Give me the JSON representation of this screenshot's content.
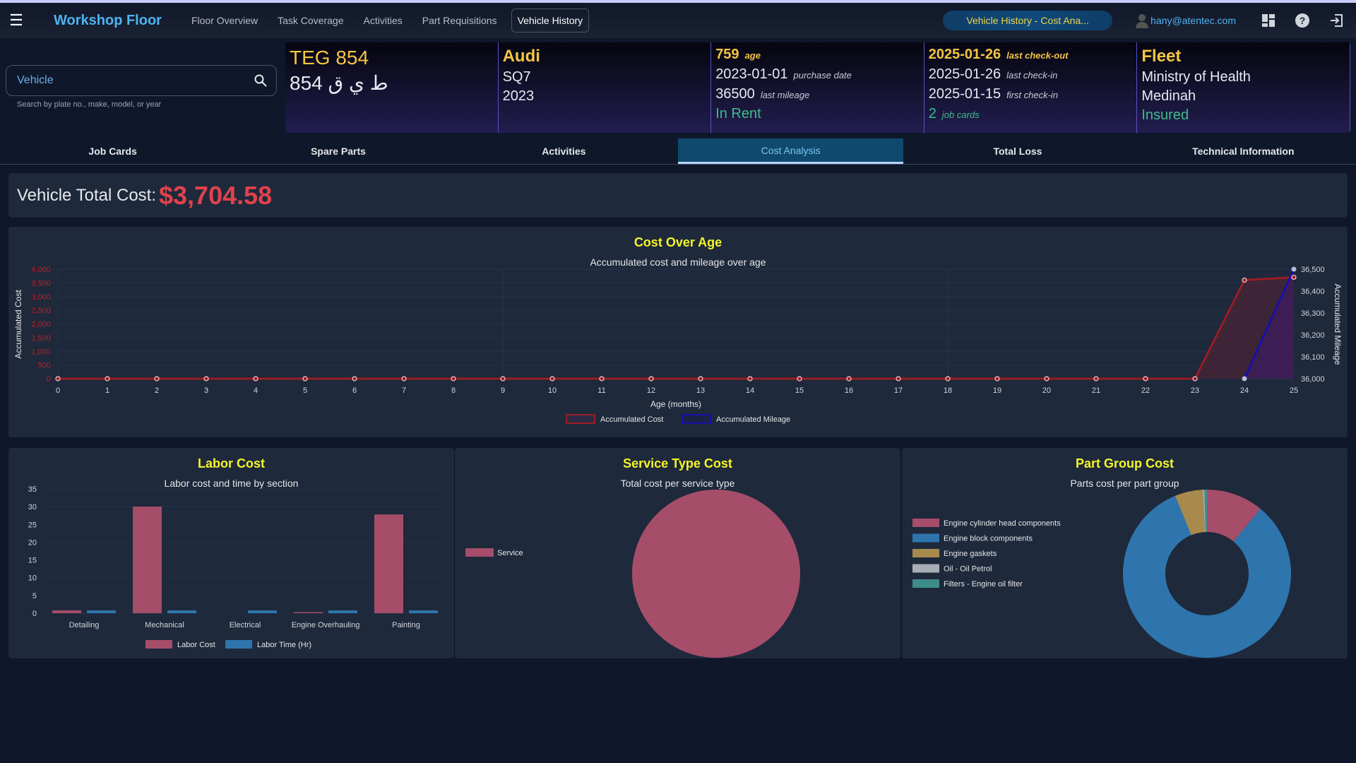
{
  "nav": {
    "brand": "Workshop Floor",
    "links": [
      {
        "label": "Floor Overview",
        "active": false
      },
      {
        "label": "Task Coverage",
        "active": false
      },
      {
        "label": "Activities",
        "active": false
      },
      {
        "label": "Part Requisitions",
        "active": false
      },
      {
        "label": "Vehicle History",
        "active": true
      }
    ],
    "context_pill": "Vehicle History - Cost Ana...",
    "user_email": "hany@atentec.com",
    "icons": [
      "menu-icon",
      "user-icon",
      "dashboard-icon",
      "help-icon",
      "logout-icon"
    ]
  },
  "search": {
    "placeholder": "Vehicle",
    "value": "",
    "hint": "Search by plate no., make, model, or year"
  },
  "vehicle": {
    "plate_en": "TEG 854",
    "plate_ar": "854 ط ي ق",
    "make": "Audi",
    "model": "SQ7",
    "year": "2023",
    "age_value": "759",
    "age_label": "age",
    "purchase_date": "2023-01-01",
    "purchase_date_label": "purchase date",
    "last_mileage": "36500",
    "last_mileage_label": "last mileage",
    "rent_status": "In Rent",
    "last_checkout": "2025-01-26",
    "last_checkout_label": "last check-out",
    "last_checkin": "2025-01-26",
    "last_checkin_label": "last check-in",
    "first_checkin": "2025-01-15",
    "first_checkin_label": "first check-in",
    "job_cards_count": "2",
    "job_cards_label": "job cards",
    "category": "Fleet",
    "owner": "Ministry of Health",
    "city": "Medinah",
    "insurance_status": "Insured"
  },
  "tabs": [
    {
      "label": "Job Cards",
      "active": false
    },
    {
      "label": "Spare Parts",
      "active": false
    },
    {
      "label": "Activities",
      "active": false
    },
    {
      "label": "Cost Analysis",
      "active": true
    },
    {
      "label": "Total Loss",
      "active": false
    },
    {
      "label": "Technical Information",
      "active": false
    }
  ],
  "total_cost": {
    "label": "Vehicle Total Cost:",
    "value": "$3,704.58"
  },
  "colors": {
    "accent": "#4fb3f0",
    "title_yellow": "#f5f527",
    "cost_red": "#e0424c",
    "labor_cost": "#a64d6a",
    "labor_time": "#2e75ad"
  },
  "chart_data": [
    {
      "id": "cost_over_age",
      "type": "line",
      "title": "Cost Over Age",
      "subtitle": "Accumulated cost and mileage over age",
      "xlabel": "Age (months)",
      "ylabel": "Accumulated Cost",
      "y2label": "Accumulated Mileage",
      "x": [
        0,
        1,
        2,
        3,
        4,
        5,
        6,
        7,
        8,
        9,
        10,
        11,
        12,
        13,
        14,
        15,
        16,
        17,
        18,
        19,
        20,
        21,
        22,
        23,
        24,
        25
      ],
      "ylim": [
        0,
        4000
      ],
      "yticks": [
        "0",
        "500",
        "1,000",
        "1,500",
        "2,000",
        "2,500",
        "3,000",
        "3,500",
        "4,000"
      ],
      "y2lim": [
        36000,
        36500
      ],
      "y2ticks": [
        "36,000",
        "36,100",
        "36,200",
        "36,300",
        "36,400",
        "36,500"
      ],
      "grid": true,
      "legend": "bottom",
      "series": [
        {
          "name": "Accumulated Cost",
          "axis": "left",
          "color": "#9b1c24",
          "values": [
            0,
            0,
            0,
            0,
            0,
            0,
            0,
            0,
            0,
            0,
            0,
            0,
            0,
            0,
            0,
            0,
            0,
            0,
            0,
            0,
            0,
            0,
            0,
            0,
            3600,
            3704.58
          ]
        },
        {
          "name": "Accumulated Mileage",
          "axis": "right",
          "color": "#1a0fa8",
          "values": [
            null,
            null,
            null,
            null,
            null,
            null,
            null,
            null,
            null,
            null,
            null,
            null,
            null,
            null,
            null,
            null,
            null,
            null,
            null,
            null,
            null,
            null,
            null,
            null,
            36000,
            36500
          ]
        }
      ]
    },
    {
      "id": "labor_cost",
      "type": "bar",
      "title": "Labor Cost",
      "subtitle": "Labor cost and time by section",
      "categories": [
        "Detailing",
        "Mechanical",
        "Electrical",
        "Engine Overhauling",
        "Painting"
      ],
      "ylim": [
        0,
        35
      ],
      "yticks": [
        "0",
        "5",
        "10",
        "15",
        "20",
        "25",
        "30",
        "35"
      ],
      "legend": "bottom",
      "series": [
        {
          "name": "Labor Cost",
          "color": "#a64d6a",
          "values": [
            0.8,
            30,
            0,
            0.3,
            27.8
          ]
        },
        {
          "name": "Labor Time (Hr)",
          "color": "#2e75ad",
          "values": [
            0.8,
            0.8,
            0.8,
            0.8,
            0.8
          ]
        }
      ]
    },
    {
      "id": "service_type_cost",
      "type": "pie",
      "title": "Service Type Cost",
      "subtitle": "Total cost per service type",
      "legend": "left",
      "labels": [
        "Service"
      ],
      "values": [
        100
      ],
      "colors": [
        "#a64d6a"
      ]
    },
    {
      "id": "part_group_cost",
      "type": "pie",
      "donut": true,
      "title": "Part Group Cost",
      "subtitle": "Parts cost per part group",
      "legend": "left",
      "labels": [
        "Engine cylinder head components",
        "Engine block components",
        "Engine gaskets",
        "Oil - Oil Petrol",
        "Filters - Engine oil filter"
      ],
      "values": [
        11,
        83,
        5.4,
        0.3,
        0.5
      ],
      "colors": [
        "#a64d6a",
        "#2e75ad",
        "#a88a4c",
        "#a8aeb6",
        "#3d8d8d"
      ]
    }
  ]
}
